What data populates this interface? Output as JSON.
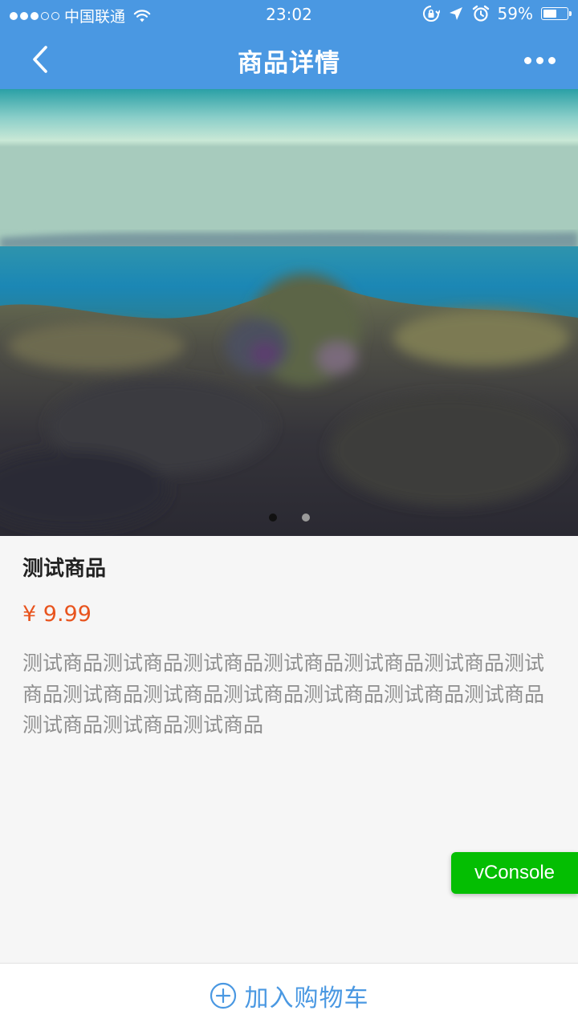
{
  "status_bar": {
    "carrier": "中国联通",
    "time": "23:02",
    "battery_percent": "59%",
    "battery_level": 0.59,
    "signal_bars_filled": 3,
    "signal_bars_total": 5
  },
  "nav": {
    "title": "商品详情"
  },
  "carousel": {
    "slide_count": 2,
    "active_index": 0
  },
  "product": {
    "name": "测试商品",
    "price": "¥ 9.99",
    "description": "测试商品测试商品测试商品测试商品测试商品测试商品测试商品测试商品测试商品测试商品测试商品测试商品测试商品测试商品测试商品测试商品"
  },
  "vconsole": {
    "label": "vConsole"
  },
  "bottom": {
    "add_to_cart_label": "加入购物车"
  },
  "colors": {
    "primary": "#4a98e2",
    "price": "#e8541e",
    "vconsole": "#04be02",
    "description": "#8f8f8f"
  },
  "icons": {
    "back": "chevron-left-icon",
    "more": "more-icon",
    "add_cart": "plus-circle-icon",
    "wifi": "wifi-icon",
    "lock_rotation": "rotation-lock-icon",
    "location": "location-arrow-icon",
    "alarm": "alarm-icon",
    "battery": "battery-icon"
  }
}
